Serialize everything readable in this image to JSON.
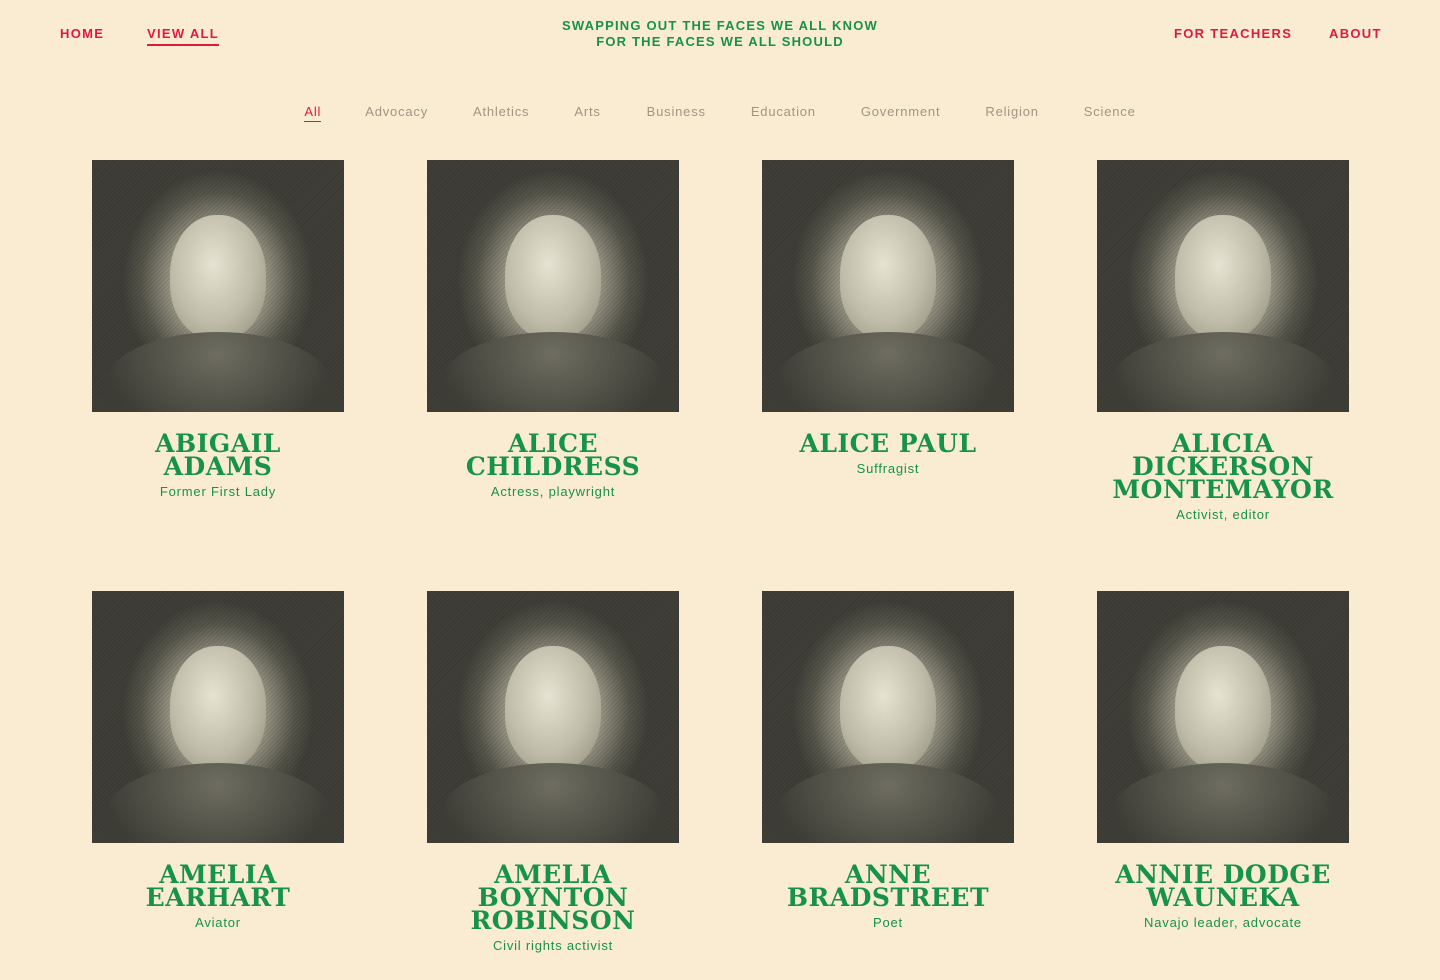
{
  "nav": {
    "home": "HOME",
    "view_all": "VIEW ALL",
    "for_teachers": "FOR TEACHERS",
    "about": "ABOUT"
  },
  "tagline": {
    "line1": "SWAPPING OUT THE FACES WE ALL KNOW",
    "line2": "FOR THE FACES WE ALL SHOULD"
  },
  "filters": [
    "All",
    "Advocacy",
    "Athletics",
    "Arts",
    "Business",
    "Education",
    "Government",
    "Religion",
    "Science"
  ],
  "active_filter": "All",
  "people": [
    {
      "name_lines": [
        "ABIGAIL",
        "ADAMS"
      ],
      "role": "Former First Lady"
    },
    {
      "name_lines": [
        "ALICE",
        "CHILDRESS"
      ],
      "role": "Actress, playwright"
    },
    {
      "name_lines": [
        "ALICE PAUL"
      ],
      "role": "Suffragist"
    },
    {
      "name_lines": [
        "ALICIA",
        "DICKERSON",
        "MONTEMAYOR"
      ],
      "role": "Activist, editor"
    },
    {
      "name_lines": [
        "AMELIA",
        "EARHART"
      ],
      "role": "Aviator"
    },
    {
      "name_lines": [
        "AMELIA",
        "BOYNTON",
        "ROBINSON"
      ],
      "role": "Civil rights activist"
    },
    {
      "name_lines": [
        "ANNE",
        "BRADSTREET"
      ],
      "role": "Poet"
    },
    {
      "name_lines": [
        "ANNIE DODGE",
        "WAUNEKA"
      ],
      "role": "Navajo leader, advocate"
    }
  ],
  "colors": {
    "background": "#faebd3",
    "nav_red": "#e0193f",
    "brand_green": "#17924a",
    "filter_muted": "#a39484"
  }
}
